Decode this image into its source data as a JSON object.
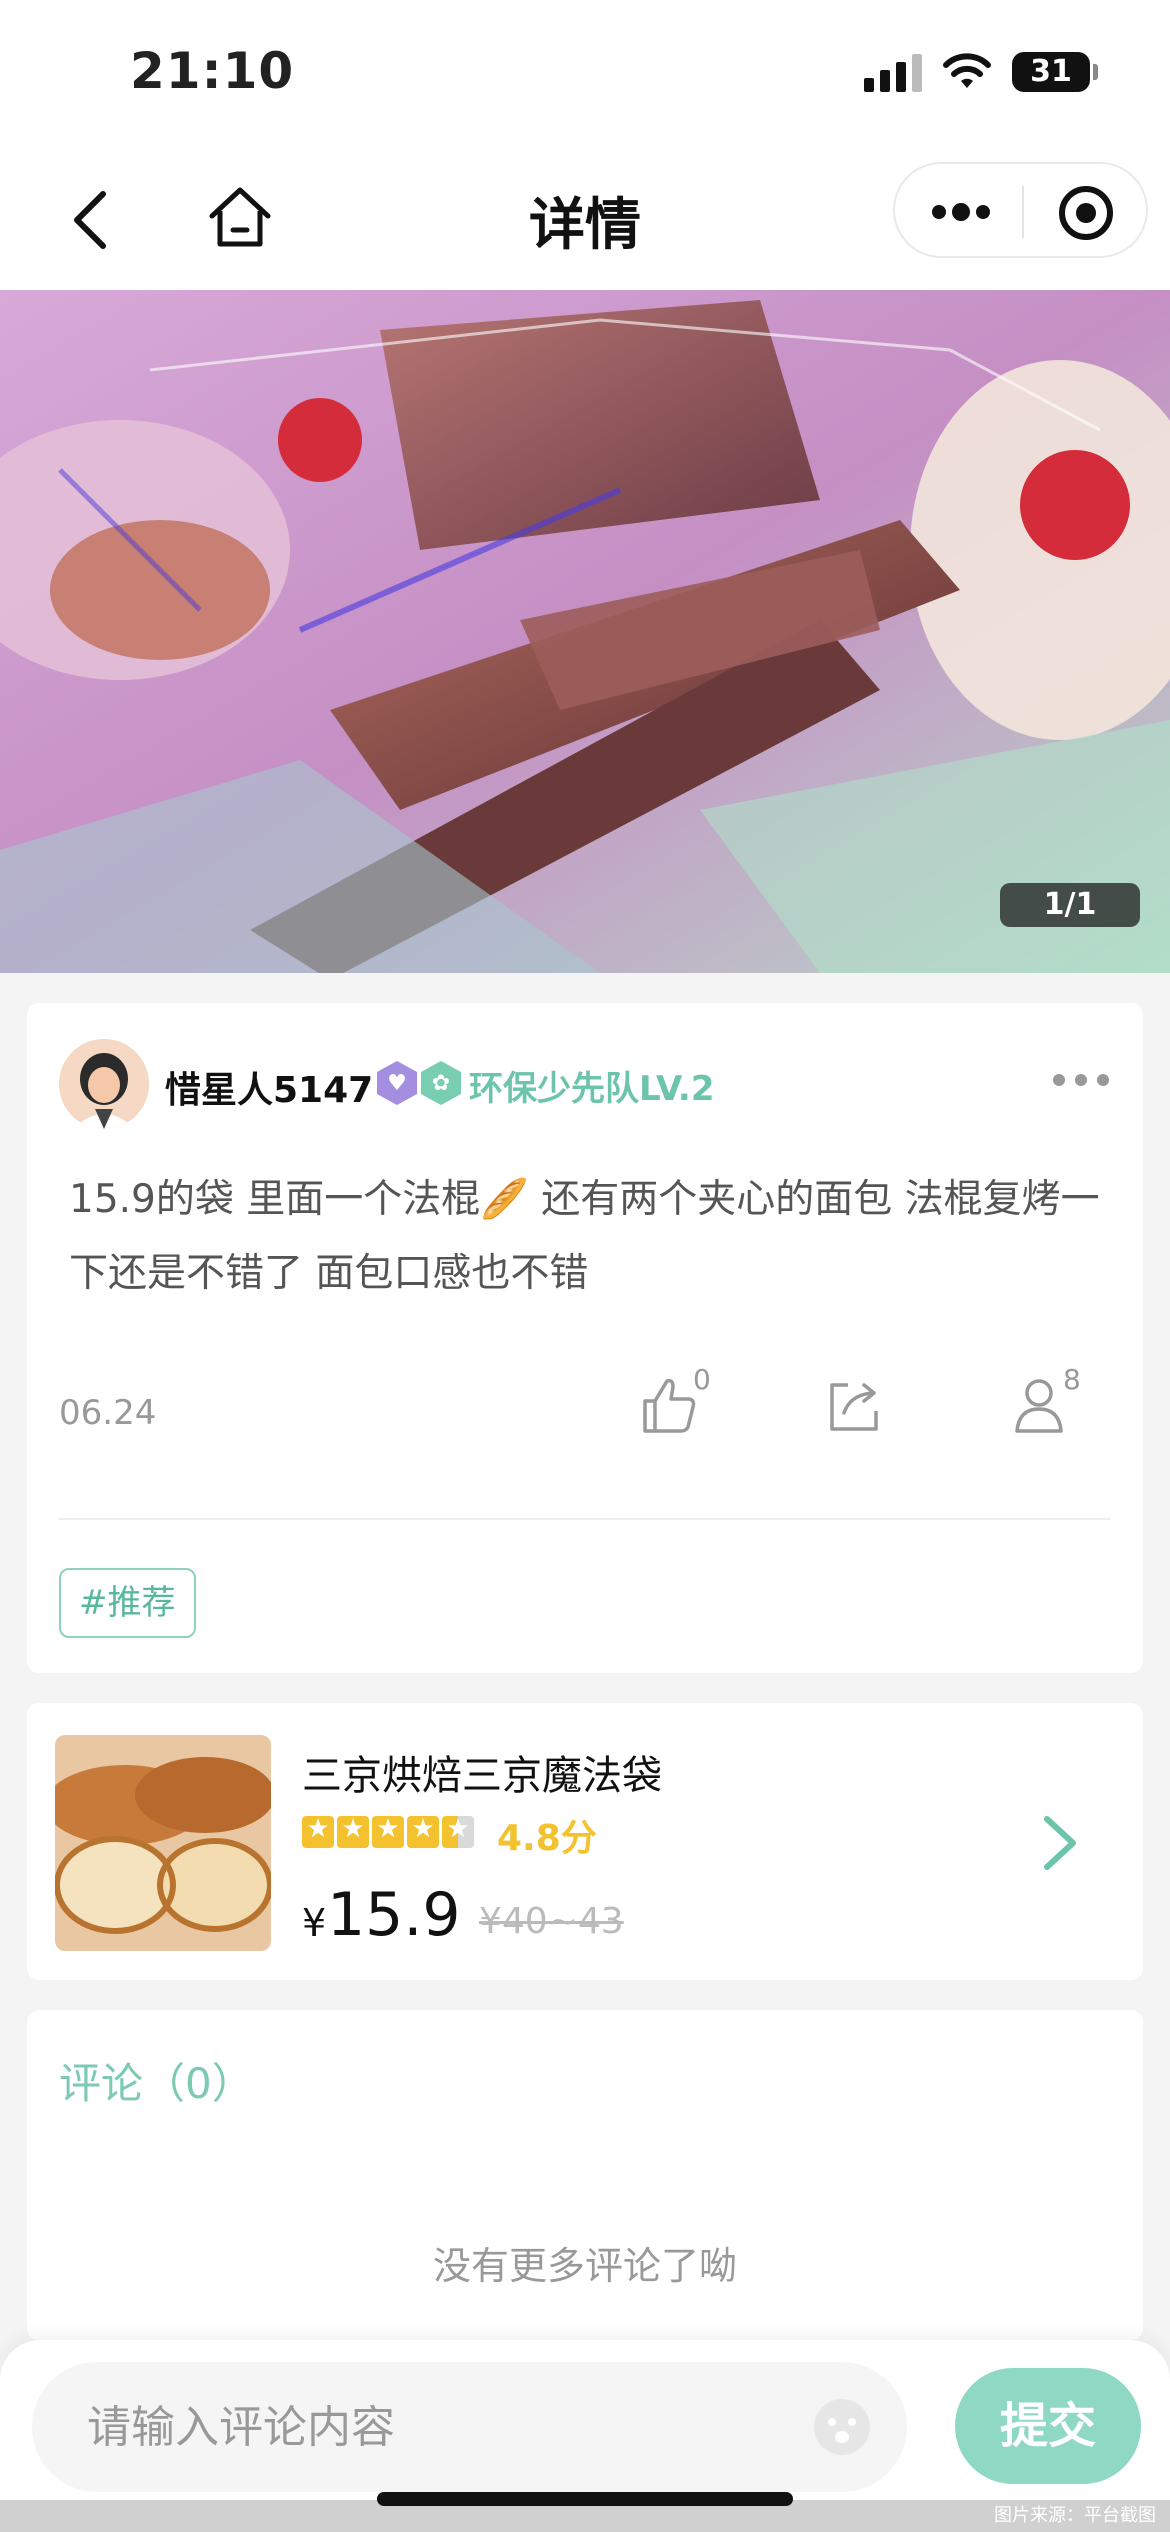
{
  "status_bar": {
    "time": "21:10",
    "battery": "31"
  },
  "nav": {
    "title": "详情"
  },
  "hero": {
    "counter": "1/1"
  },
  "post": {
    "username": "惜星人5147",
    "badge_text": "环保少先队LV.2",
    "content": "15.9的袋  里面一个法棍🥖  还有两个夹心的面包  法棍复烤一下还是不错了 面包口感也不错",
    "date": "06.24",
    "like_count": "0",
    "viewer_count": "8",
    "tag": "#推荐"
  },
  "product": {
    "name": "三京烘焙三京魔法袋",
    "rating": "4.8分",
    "price_symbol": "¥",
    "price": "15.9",
    "original_price": "¥40~43"
  },
  "comments": {
    "title": "评论（0）",
    "empty_text": "没有更多评论了呦"
  },
  "input": {
    "placeholder": "请输入评论内容",
    "submit_label": "提交"
  },
  "footer": {
    "source_note": "图片来源：平台截图"
  },
  "colors": {
    "accent": "#8fd8c4",
    "badge": "#6cc4aa",
    "star": "#f3c22e"
  }
}
